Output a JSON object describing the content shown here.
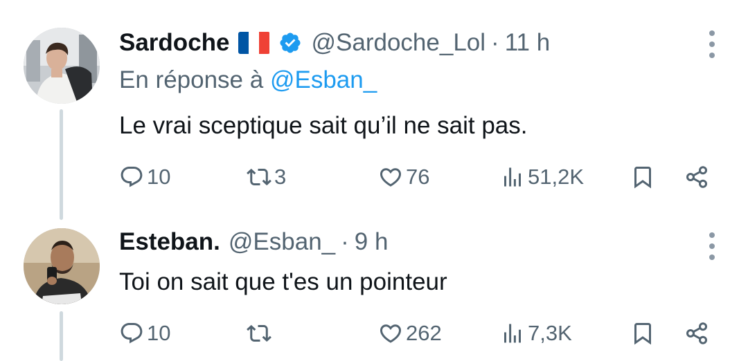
{
  "tweets": [
    {
      "author": {
        "name": "Sardoche",
        "handle": "@Sardoche_Lol",
        "time": "11 h",
        "flag": "france",
        "verified": true
      },
      "reply_prefix": "En réponse à",
      "reply_mention": "@Esban_",
      "text": "Le vrai sceptique sait qu’il ne sait pas.",
      "stats": {
        "replies": "10",
        "retweets": "3",
        "likes": "76",
        "views": "51,2K"
      }
    },
    {
      "author": {
        "name": "Esteban.",
        "handle": "@Esban_",
        "time": "9 h"
      },
      "text": "Toi on sait que t'es un pointeur",
      "stats": {
        "replies": "10",
        "retweets": "",
        "likes": "262",
        "views": "7,3K"
      }
    }
  ],
  "separator": "·",
  "colors": {
    "verified_blue": "#1d9bf0",
    "secondary_text": "#536471",
    "thread_line": "#cfd9de"
  },
  "icons": [
    "reply-icon",
    "retweet-icon",
    "like-icon",
    "views-icon",
    "bookmark-icon",
    "share-icon",
    "more-icon"
  ]
}
